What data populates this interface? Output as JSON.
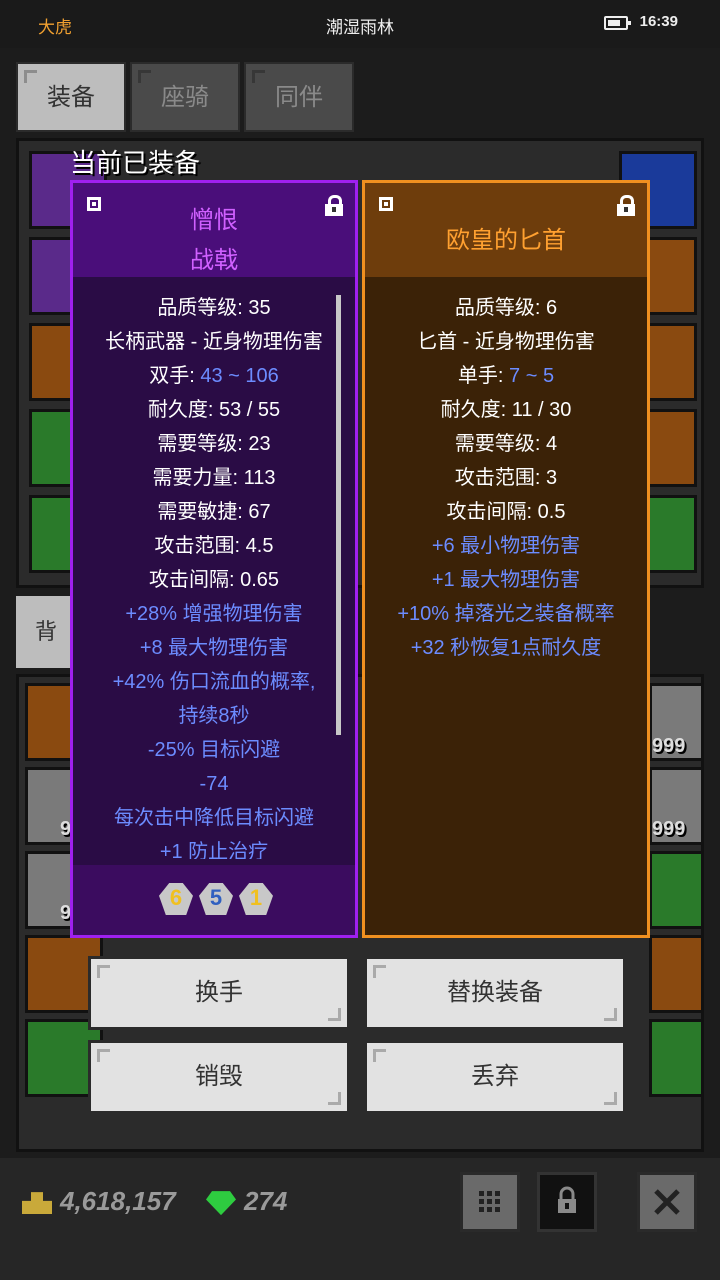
{
  "status_bar": {
    "left": "大虎",
    "title": "潮湿雨林",
    "time": "16:39"
  },
  "tabs": [
    {
      "label": "装备"
    },
    {
      "label": "座骑"
    },
    {
      "label": "同伴"
    }
  ],
  "equipped_title": "当前已装备",
  "bag_tab": "背",
  "bag_counts": [
    "999",
    "999",
    "9",
    "9"
  ],
  "left_item": {
    "name_line1": "憎恨",
    "name_line2": "战戟",
    "stats": [
      {
        "text": "品质等级: 35"
      },
      {
        "text": "长柄武器 - 近身物理伤害"
      },
      {
        "label": "双手: ",
        "value": "43 ~ 106"
      },
      {
        "text": "耐久度: 53 / 55"
      },
      {
        "text": "需要等级: 23"
      },
      {
        "text": "需要力量: 113"
      },
      {
        "text": "需要敏捷: 67"
      },
      {
        "text": "攻击范围: 4.5"
      },
      {
        "text": "攻击间隔: 0.65"
      }
    ],
    "affixes": [
      "+28% 增强物理伤害",
      "+8 最大物理伤害",
      "+42% 伤口流血的概率,",
      "持续8秒",
      "-25% 目标闪避",
      "-74",
      "每次击中降低目标闪避",
      "+1 防止治疗"
    ],
    "gems": [
      "6",
      "5",
      "1"
    ]
  },
  "right_item": {
    "name": "欧皇的匕首",
    "stats": [
      {
        "text": "品质等级: 6"
      },
      {
        "text": "匕首 - 近身物理伤害"
      },
      {
        "label": "单手: ",
        "value": "7 ~ 5"
      },
      {
        "text": "耐久度: 11 / 30"
      },
      {
        "text": "需要等级: 4"
      },
      {
        "text": "攻击范围: 3"
      },
      {
        "text": "攻击间隔: 0.5"
      }
    ],
    "affixes": [
      "+6 最小物理伤害",
      "+1 最大物理伤害",
      "+10% 掉落光之装备概率",
      "+32 秒恢复1点耐久度"
    ]
  },
  "buttons": {
    "swap_hand": "换手",
    "replace": "替换装备",
    "destroy": "销毁",
    "discard": "丢弃"
  },
  "currency": {
    "gold": "4,618,157",
    "diamonds": "274"
  },
  "colors": {
    "purple_border": "#a020f0",
    "orange_border": "#f09020",
    "affix_blue": "#6c8cff"
  }
}
